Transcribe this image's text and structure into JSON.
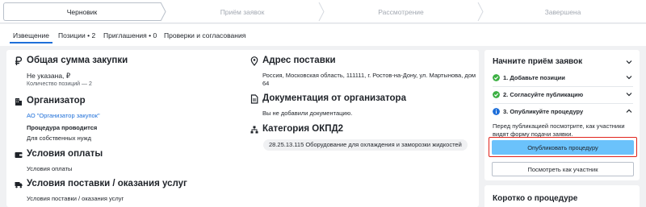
{
  "stepper": {
    "steps": [
      {
        "label": "Черновик",
        "state": "active"
      },
      {
        "label": "Приём заявок",
        "state": "inactive"
      },
      {
        "label": "Рассмотрение",
        "state": "inactive"
      },
      {
        "label": "Завершена",
        "state": "inactive"
      }
    ]
  },
  "tabs": [
    {
      "label": "Извещение",
      "active": true
    },
    {
      "label": "Позиции • 2",
      "active": false
    },
    {
      "label": "Приглашения • 0",
      "active": false
    },
    {
      "label": "Проверки и согласования",
      "active": false
    }
  ],
  "main": {
    "total": {
      "title": "Общая сумма закупки",
      "value": "Не указана, ₽",
      "count": "Количество позиций — 2"
    },
    "organizer": {
      "title": "Организатор",
      "name": "АО \"Организатор закупок\"",
      "procedure_label": "Процедура проводится",
      "procedure_value": "Для собственных нужд"
    },
    "payment": {
      "title": "Условия оплаты",
      "value": "Условия оплаты"
    },
    "delivery_terms": {
      "title": "Условия поставки / оказания услуг",
      "value": "Условия поставки / оказания услуг"
    },
    "address": {
      "title": "Адрес поставки",
      "line1": "Россия, Московская область, 111111, г. Ростов-на-Дону, ул. Мартынова, дом",
      "line2": "64"
    },
    "docs": {
      "title": "Документация от организатора",
      "value": "Вы не добавили документацию."
    },
    "okpd": {
      "title": "Категория ОКПД2",
      "chip": "28.25.13.115 Оборудование для охлаждения и заморозки жидкостей"
    }
  },
  "panel": {
    "title": "Начните приём заявок",
    "steps": [
      {
        "label": "1. Добавьте позиции",
        "status": "done"
      },
      {
        "label": "2. Согласуйте публикацию",
        "status": "done"
      },
      {
        "label": "3. Опубликуйте процедуру",
        "status": "info"
      }
    ],
    "description": "Перед публикацией посмотрите, как участники видят форму подачи заявки.",
    "publish_button": "Опубликовать процедуру",
    "preview_button": "Посмотреть как участник",
    "status_colors": {
      "done": "#3cb043",
      "info": "#1e6fd9"
    }
  },
  "panel2": {
    "title": "Коротко о процедуре"
  }
}
